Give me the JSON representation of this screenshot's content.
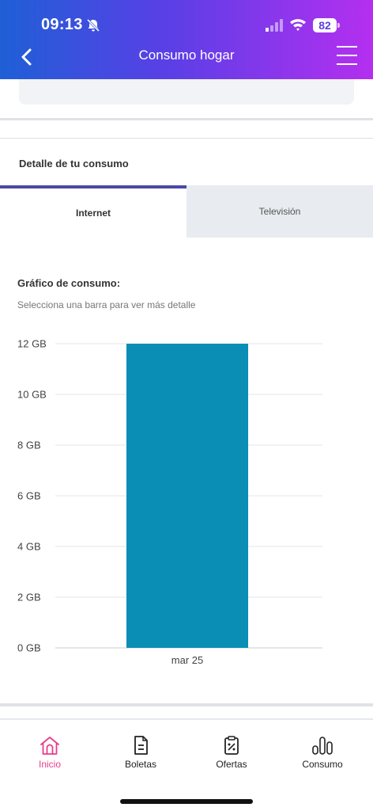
{
  "status": {
    "time": "09:13",
    "battery": "82"
  },
  "header": {
    "title": "Consumo hogar"
  },
  "detail": {
    "title": "Detalle de tu consumo"
  },
  "tabs": [
    {
      "label": "Internet",
      "active": true
    },
    {
      "label": "Televisión",
      "active": false
    }
  ],
  "chart_section": {
    "heading": "Gráfico de consumo:",
    "subtitle": "Selecciona una barra para ver más detalle"
  },
  "chart_data": {
    "type": "bar",
    "categories": [
      "mar 25"
    ],
    "values": [
      12
    ],
    "unit": "GB",
    "ylim": [
      0,
      12
    ],
    "yticks": [
      "0 GB",
      "2 GB",
      "4 GB",
      "6 GB",
      "8 GB",
      "10 GB",
      "12 GB"
    ],
    "grid": true,
    "bar_color": "#0a8eb5"
  },
  "bottom_nav": [
    {
      "label": "Inicio",
      "icon": "home-icon",
      "active": true
    },
    {
      "label": "Boletas",
      "icon": "document-icon",
      "active": false
    },
    {
      "label": "Ofertas",
      "icon": "offers-clipboard-icon",
      "active": false
    },
    {
      "label": "Consumo",
      "icon": "bar-chart-icon",
      "active": false
    }
  ],
  "colors": {
    "header_gradient_start": "#1f5fd6",
    "header_gradient_end": "#b52ff0",
    "active_tab_border": "#4b4aa6",
    "active_nav": "#e83e8c"
  }
}
